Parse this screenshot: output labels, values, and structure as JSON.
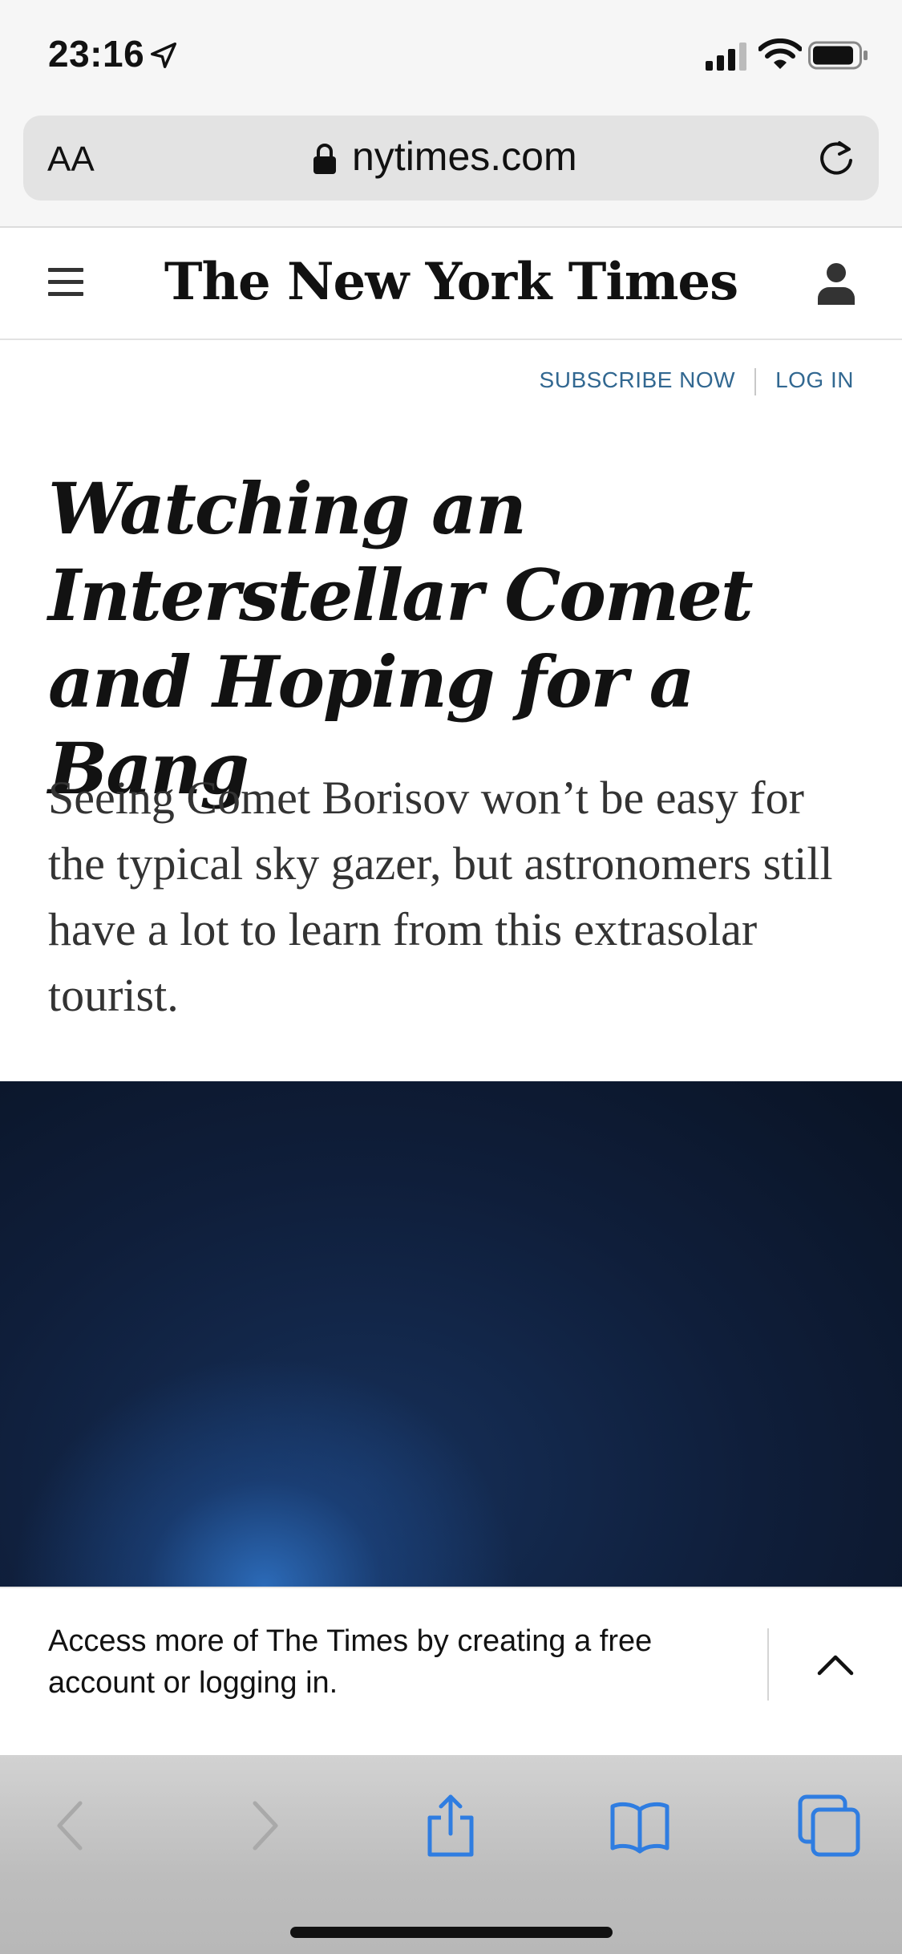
{
  "status_bar": {
    "time": "23:16"
  },
  "browser": {
    "text_size_label": "AA",
    "url": "nytimes.com"
  },
  "site": {
    "logo": "The New York Times",
    "subscribe_label": "SUBSCRIBE NOW",
    "login_label": "LOG IN"
  },
  "article": {
    "headline": "Watching an Interstellar Comet and Hoping for a Bang",
    "summary": "Seeing Comet Borisov won’t be easy for the typical sky gazer, but astronomers still have a lot to learn from this extrasolar tourist."
  },
  "banner": {
    "text": "Access more of The Times by creating a free account or logging in."
  },
  "toolbar": {
    "icons": [
      "back-icon",
      "forward-icon",
      "share-icon",
      "bookmarks-icon",
      "tabs-icon"
    ]
  },
  "colors": {
    "link": "#326891",
    "safari_blue": "#2f7de1",
    "disabled": "#a9a9a9"
  }
}
